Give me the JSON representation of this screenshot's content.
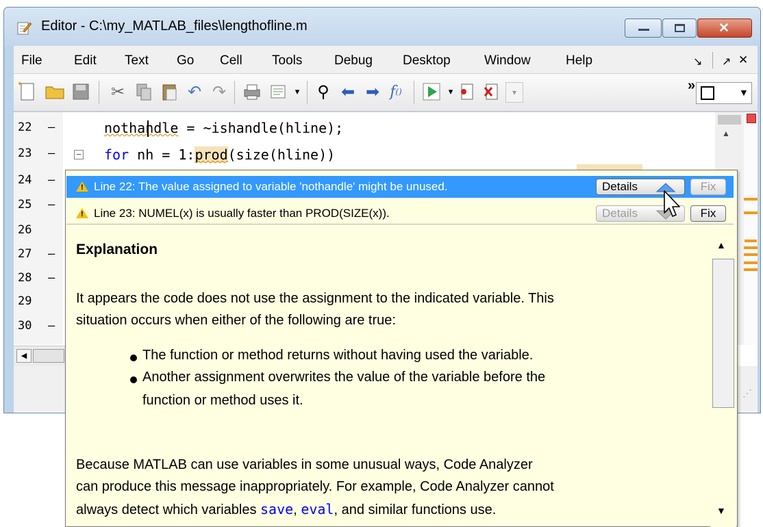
{
  "window": {
    "title": "Editor - C:\\my_MATLAB_files\\lengthofline.m",
    "min_glyph": "—",
    "max_glyph": "□",
    "close_glyph": "✕"
  },
  "menu": {
    "items": [
      "File",
      "Edit",
      "Text",
      "Go",
      "Cell",
      "Tools",
      "Debug",
      "Desktop",
      "Window",
      "Help"
    ],
    "right_glyphs": [
      "↘",
      "↗",
      "✕"
    ]
  },
  "toolbar": {
    "overflow_label": "»"
  },
  "editor": {
    "line_numbers": [
      "22",
      "23",
      "24",
      "25",
      "26",
      "27",
      "28",
      "29",
      "30"
    ],
    "dashes": [
      "–",
      "–",
      "–",
      "–",
      "",
      "–",
      "–",
      "",
      "–"
    ],
    "line22": {
      "squiggled": "nothandle",
      "rest": " = ~ishandle(hline);"
    },
    "line23": {
      "kw": "for",
      "mid": " nh = 1:",
      "squiggled": "prod",
      "rest": "(size(hline))"
    }
  },
  "popup": {
    "messages": [
      {
        "text": "Line 22: The value assigned to variable 'nothandle' might be unused.",
        "details": "Details",
        "fix": "Fix"
      },
      {
        "text": "Line 23: NUMEL(x) is usually faster than PROD(SIZE(x)).",
        "details": "Details",
        "fix": "Fix"
      }
    ],
    "explanation_title": "Explanation",
    "paragraph1": [
      "It appears the code does not use the assignment to the indicated variable. This",
      "situation occurs when either of the following are true:"
    ],
    "bullets": [
      [
        "The function or method returns without having used the variable."
      ],
      [
        "Another assignment overwrites the value of the variable before the",
        "function or method uses it."
      ]
    ],
    "paragraph2": [
      "Because MATLAB can use variables in some unusual ways, Code Analyzer",
      "can produce this message inappropriately. For example, Code Analyzer cannot"
    ],
    "paragraph2_last": {
      "pre": "always detect which variables ",
      "code1": "save",
      "sep": ", ",
      "code2": "eval",
      "post": ", and similar functions use."
    }
  },
  "colors": {
    "selection": "#3399ff",
    "popup_bg": "#ffffe1",
    "warning": "#f2c200",
    "keyword": "#0000ff",
    "marker": "#f09a1a"
  }
}
